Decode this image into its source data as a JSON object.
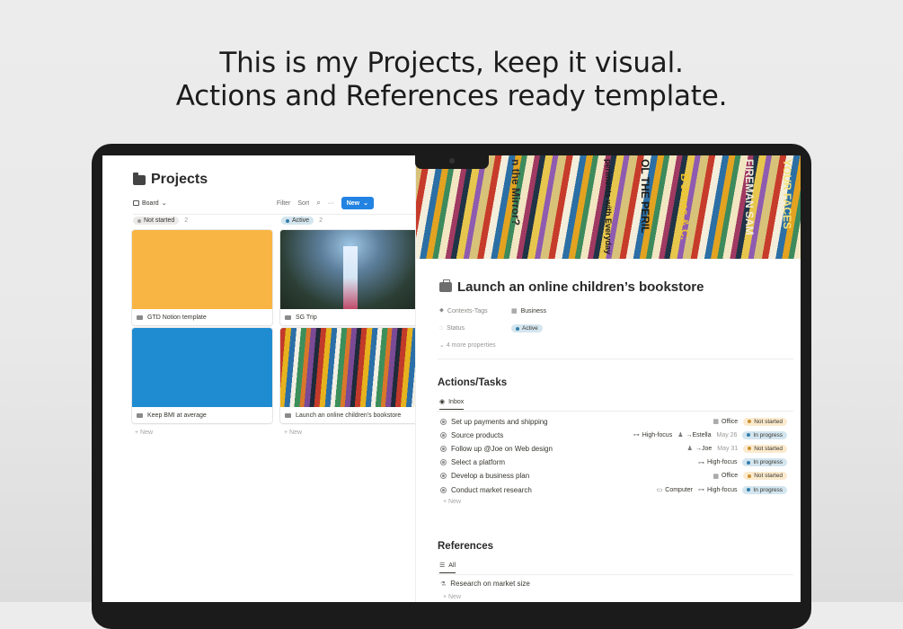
{
  "headline": {
    "line1": "This is my Projects, keep it visual.",
    "line2": "Actions and References ready template."
  },
  "board": {
    "title": "Projects",
    "title_icon": "folder-icon",
    "view_label": "Board",
    "filter_label": "Filter",
    "sort_label": "Sort",
    "more_label": "···",
    "new_label": "New",
    "columns": [
      {
        "status": "Not started",
        "count": "2",
        "color": "#9b9a97",
        "cards": [
          {
            "title": "GTD Notion template",
            "cover": "#f9b543"
          },
          {
            "title": "Keep BMI at average",
            "cover": "#1f8bd1"
          }
        ]
      },
      {
        "status": "Active",
        "count": "2",
        "color": "#337ea9",
        "cards": [
          {
            "title": "SG Trip",
            "cover": "photo-jewel"
          },
          {
            "title": "Launch an online children's bookstore",
            "cover": "photo-books"
          }
        ]
      }
    ],
    "add_new_label": "+ New"
  },
  "page": {
    "title": "Launch an online children’s bookstore",
    "title_icon": "briefcase-icon",
    "banner_spines": [
      "n the Mirror?",
      "OL THE PERIL",
      "periments with Everyday",
      "B Jones & C.",
      "FIREMAN SAM",
      "YOUR FACES"
    ],
    "props": {
      "contexts_label": "Contexts-Tags",
      "contexts_value": "Business",
      "status_label": "Status",
      "status_value": "Active",
      "more_label": "4 more properties"
    },
    "actions": {
      "heading": "Actions/Tasks",
      "tab": "Inbox",
      "tasks": [
        {
          "name": "Set up payments and shipping",
          "ctx": "Office",
          "ctx_icon": "building-icon",
          "energy": "",
          "person": "",
          "date": "",
          "status": "Not started",
          "status_kind": "ns"
        },
        {
          "name": "Source products",
          "ctx": "",
          "ctx_icon": "",
          "energy": "High-focus",
          "person": "→Estella",
          "date": "May 26",
          "status": "In progress",
          "status_kind": "ip"
        },
        {
          "name": "Follow up @Joe on Web design",
          "ctx": "",
          "ctx_icon": "",
          "energy": "",
          "person": "→Joe",
          "date": "May 31",
          "status": "Not started",
          "status_kind": "ns"
        },
        {
          "name": "Select a platform",
          "ctx": "",
          "ctx_icon": "",
          "energy": "High-focus",
          "person": "",
          "date": "",
          "status": "In progress",
          "status_kind": "ip"
        },
        {
          "name": "Develop a business plan",
          "ctx": "Office",
          "ctx_icon": "building-icon",
          "energy": "",
          "person": "",
          "date": "",
          "status": "Not started",
          "status_kind": "ns"
        },
        {
          "name": "Conduct market research",
          "ctx": "Computer",
          "ctx_icon": "computer-icon",
          "energy": "High-focus",
          "person": "",
          "date": "",
          "status": "In progress",
          "status_kind": "ip"
        }
      ],
      "add_new_label": "+ New"
    },
    "references": {
      "heading": "References",
      "tab": "All",
      "items": [
        {
          "name": "Research on market size"
        }
      ],
      "add_new_label": "+ New"
    }
  }
}
